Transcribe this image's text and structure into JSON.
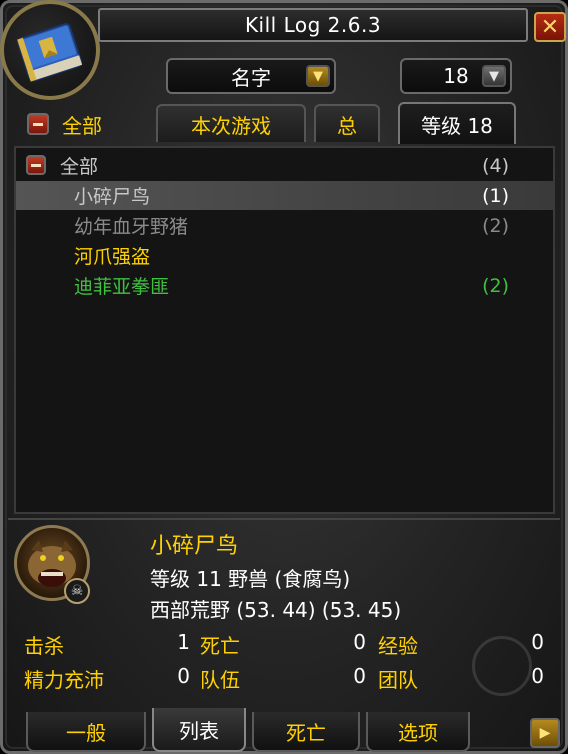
{
  "window": {
    "title": "Kill Log 2.6.3",
    "close_symbol": "✕"
  },
  "filters": {
    "sort_dropdown": "名字",
    "level_dropdown": "18"
  },
  "top_tabs": {
    "all_label": "全部",
    "session_label": "本次游戏",
    "total_label": "总",
    "level_label": "等级 18"
  },
  "list": {
    "header": {
      "label": "全部",
      "count": "(4)"
    },
    "items": [
      {
        "name": "小碎尸鸟",
        "count": "(1)",
        "color": "#c8c8c8"
      },
      {
        "name": "幼年血牙野猪",
        "count": "(2)",
        "color": "#8a8a8a"
      },
      {
        "name": "河爪强盗",
        "count": "",
        "color": "#ffd100"
      },
      {
        "name": "迪菲亚拳匪",
        "count": "(2)",
        "color": "#40c040"
      }
    ]
  },
  "detail": {
    "name": "小碎尸鸟",
    "level_line": "等级 11 野兽 (食腐鸟)",
    "location_line": "西部荒野 (53. 44) (53. 45)"
  },
  "stats": {
    "kills_label": "击杀",
    "kills_value": "1",
    "deaths_label": "死亡",
    "deaths_value": "0",
    "xp_label": "经验",
    "xp_value": "0",
    "rested_label": "精力充沛",
    "rested_value": "0",
    "party_label": "队伍",
    "party_value": "0",
    "raid_label": "团队",
    "raid_value": "0"
  },
  "bottom_tabs": {
    "general": "一般",
    "list": "列表",
    "deaths": "死亡",
    "options": "选项"
  },
  "colors": {
    "gold": "#ffd100",
    "green": "#40c040",
    "gray": "#8a8a8a"
  }
}
